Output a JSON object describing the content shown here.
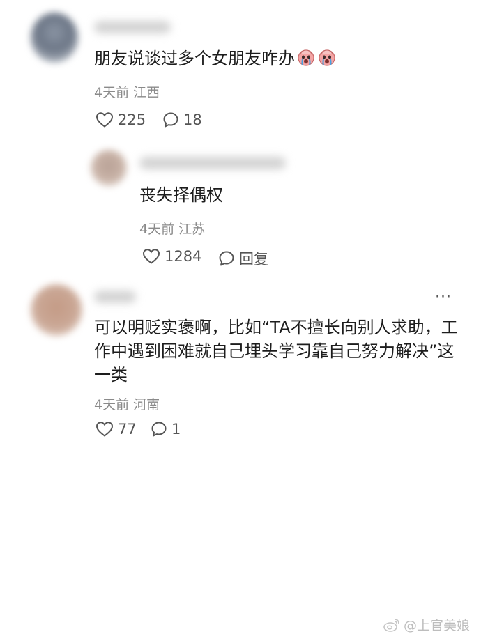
{
  "comments": [
    {
      "text": "朋友说谈过多个女朋友咋办",
      "emoji_icons": [
        "crying-face-icon",
        "crying-face-icon"
      ],
      "time": "4天前",
      "location": "江西",
      "likes": "225",
      "replies": "18"
    },
    {
      "text": "丧失择偶权",
      "time": "4天前",
      "location": "江苏",
      "likes": "1284",
      "reply_label": "回复"
    },
    {
      "text_lines": [
        "可以明贬实褒啊，比如“TA不擅长向别人求助，工",
        "作中遇到困难就自己埋头学习靠自己努力解决”这",
        "一类"
      ],
      "time": "4天前",
      "location": "河南",
      "likes": "77",
      "replies": "1",
      "more_label": "···"
    }
  ],
  "watermark": "@上官美娘",
  "watermark_icon": "weibo-logo-icon"
}
